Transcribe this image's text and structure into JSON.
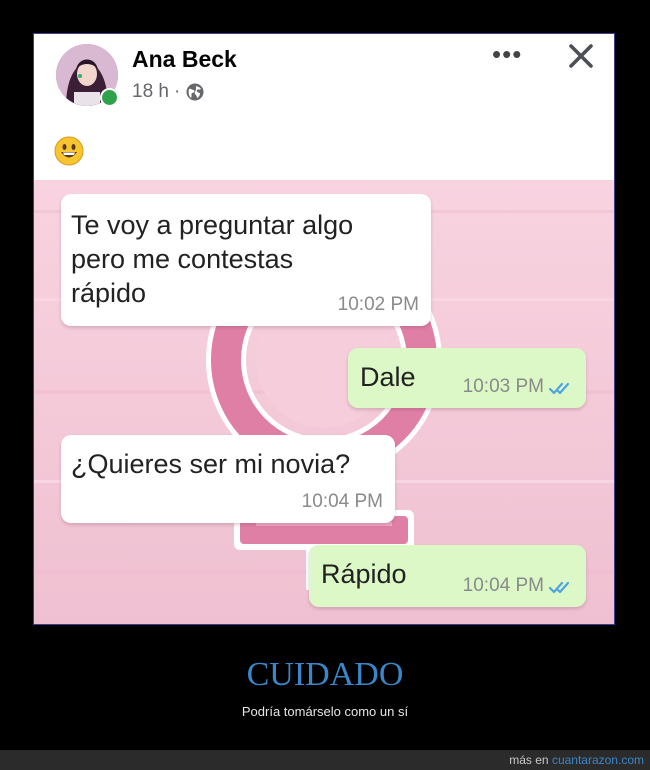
{
  "post": {
    "author_name": "Ana Beck",
    "time": "18 h",
    "separator": "·",
    "privacy_icon": "globe-icon",
    "more_icon": "more-horizontal-icon",
    "close_icon": "close-icon",
    "status": "online",
    "body_emoji": "grinning-face-emoji"
  },
  "chat": {
    "messages": [
      {
        "direction": "incoming",
        "text_lines": [
          "Te voy a preguntar algo",
          "pero me contestas",
          "rápido"
        ],
        "time": "10:02 PM"
      },
      {
        "direction": "outgoing",
        "text": "Dale",
        "time": "10:03 PM",
        "read": true
      },
      {
        "direction": "incoming",
        "text": "¿Quieres ser mi novia?",
        "time": "10:04 PM"
      },
      {
        "direction": "outgoing",
        "text": "Rápido",
        "time": "10:04 PM",
        "read": true
      }
    ]
  },
  "caption": {
    "title": "CUIDADO",
    "subtitle": "Podría tomárselo como un sí"
  },
  "footer": {
    "prefix": "más en",
    "site": "cuantarazon.com"
  },
  "colors": {
    "online": "#31a24c",
    "incoming_bubble": "#ffffff",
    "outgoing_bubble": "#dcf8c6",
    "read_ticks": "#4fa3e0",
    "chat_background": "#f5cbd9",
    "caption_title": "#3a86c8"
  }
}
